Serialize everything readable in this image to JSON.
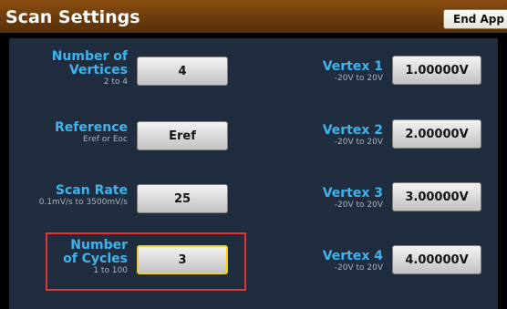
{
  "header": {
    "title": "Scan Settings",
    "end_app_label": "End App"
  },
  "left_settings": [
    {
      "label": "Number of Vertices",
      "label_line1": "Number of",
      "label_line2": "Vertices",
      "range": "2 to 4",
      "value": "4"
    },
    {
      "label": "Reference",
      "range": "Eref or Eoc",
      "value": "Eref"
    },
    {
      "label": "Scan Rate",
      "range": "0.1mV/s to 3500mV/s",
      "value": "25"
    },
    {
      "label": "Number of Cycles",
      "label_line1": "Number",
      "label_line2": "of Cycles",
      "range": "1 to 100",
      "value": "3",
      "selected": true
    }
  ],
  "vertices": [
    {
      "label": "Vertex 1",
      "range": "-20V to 20V",
      "value": "1.00000V"
    },
    {
      "label": "Vertex 2",
      "range": "-20V to 20V",
      "value": "2.00000V"
    },
    {
      "label": "Vertex 3",
      "range": "-20V to 20V",
      "value": "3.00000V"
    },
    {
      "label": "Vertex 4",
      "range": "-20V to 20V",
      "value": "4.00000V"
    }
  ],
  "colors": {
    "label_blue": "#3fb3ee",
    "title_bar": "#6a3a0c",
    "panel_bg": "#1f2d3e",
    "selection_outline": "#f2d21a",
    "annotation_box": "#e23636"
  }
}
